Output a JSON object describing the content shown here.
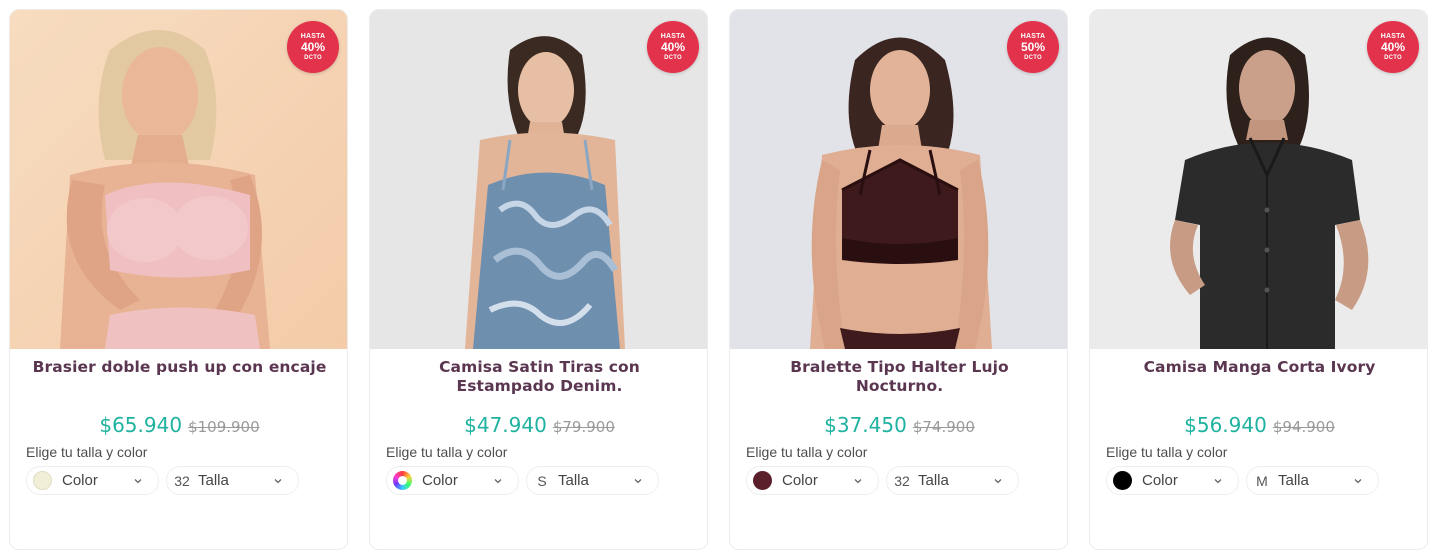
{
  "products": [
    {
      "badge": {
        "top": "HASTA",
        "pct": "40%",
        "bottom": "DCTO"
      },
      "title": "Brasier doble push up con encaje",
      "price": "$65.940",
      "old_price": "$109.900",
      "picker_label": "Elige tu talla y color",
      "color_label": "Color",
      "color_swatch": "#f1efd8",
      "size_code": "32",
      "size_label": "Talla"
    },
    {
      "badge": {
        "top": "HASTA",
        "pct": "40%",
        "bottom": "DCTO"
      },
      "title": "Camisa Satin Tiras con Estampado Denim.",
      "price": "$47.940",
      "old_price": "$79.900",
      "picker_label": "Elige tu talla y color",
      "color_label": "Color",
      "color_swatch": "multicolor",
      "size_code": "S",
      "size_label": "Talla"
    },
    {
      "badge": {
        "top": "HASTA",
        "pct": "50%",
        "bottom": "DCTO"
      },
      "title": "Bralette Tipo Halter Lujo Nocturno.",
      "price": "$37.450",
      "old_price": "$74.900",
      "picker_label": "Elige tu talla y color",
      "color_label": "Color",
      "color_swatch": "#5a1f2a",
      "size_code": "32",
      "size_label": "Talla"
    },
    {
      "badge": {
        "top": "HASTA",
        "pct": "40%",
        "bottom": "DCTO"
      },
      "title": "Camisa Manga Corta Ivory",
      "price": "$56.940",
      "old_price": "$94.900",
      "picker_label": "Elige tu talla y color",
      "color_label": "Color",
      "color_swatch": "#000000",
      "size_code": "M",
      "size_label": "Talla"
    }
  ],
  "colors": {
    "title": "#5b3651",
    "price": "#1fb2a0",
    "old_price": "#9a9a9a",
    "badge": "#e3324b"
  },
  "icons": {
    "select_arrow": "chevron-down-icon"
  }
}
